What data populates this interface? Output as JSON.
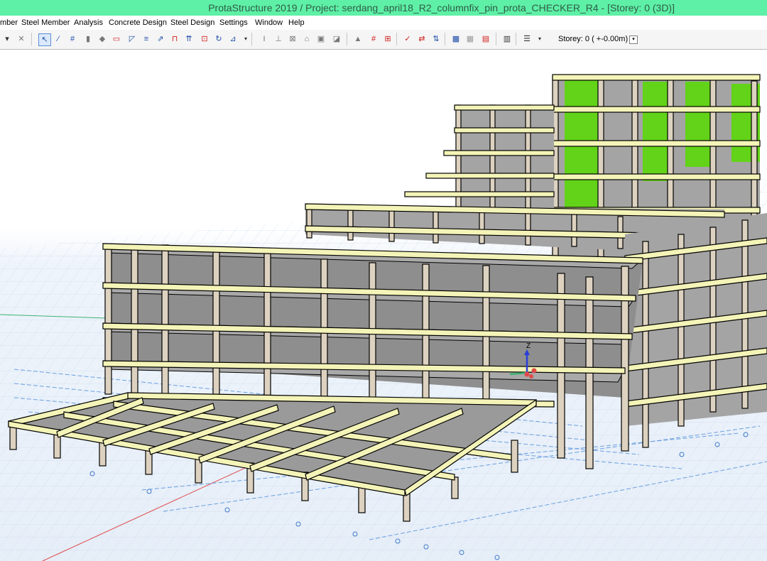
{
  "window": {
    "title": "ProtaStructure 2019 / Project: serdang_april18_R2_columnfix_pin_prota_CHECKER_R4 - [Storey: 0 (3D)]"
  },
  "menu": {
    "items": [
      {
        "label": "mber"
      },
      {
        "label": "Steel Member"
      },
      {
        "label": "Analysis"
      },
      {
        "label": "Concrete Design"
      },
      {
        "label": "Steel Design"
      },
      {
        "label": "Settings"
      },
      {
        "label": "Window"
      },
      {
        "label": "Help"
      }
    ]
  },
  "toolbar": {
    "storey_label": "Storey: 0 ( +-0.00m)",
    "storey_dropdown_glyph": "▾",
    "buttons": [
      "select-icon",
      "line-icon",
      "grid-icon",
      "column-icon",
      "wall-icon",
      "beam-icon",
      "slab-icon",
      "stair-icon",
      "load-icon",
      "axis-icon",
      "dimension-icon",
      "move-icon",
      "section-icon",
      "plan-icon",
      "view-icon",
      "render-icon",
      "shape-icon",
      "mesh-icon",
      "member-icon",
      "frame-icon",
      "check-icon",
      "arrow-icon",
      "settings-icon",
      "table-icon",
      "layers-icon",
      "options-icon"
    ]
  },
  "viewport": {
    "axis_label": "Z",
    "colors": {
      "beam": "#f4f4b8",
      "column": "#ddd2c0",
      "slab": "#9a9a9a",
      "wall": "#62d318",
      "grid": "#6a9fe0",
      "axis_x": "#e04a4a",
      "axis_y": "#3cb371",
      "axis_z": "#2a3fd8"
    }
  }
}
